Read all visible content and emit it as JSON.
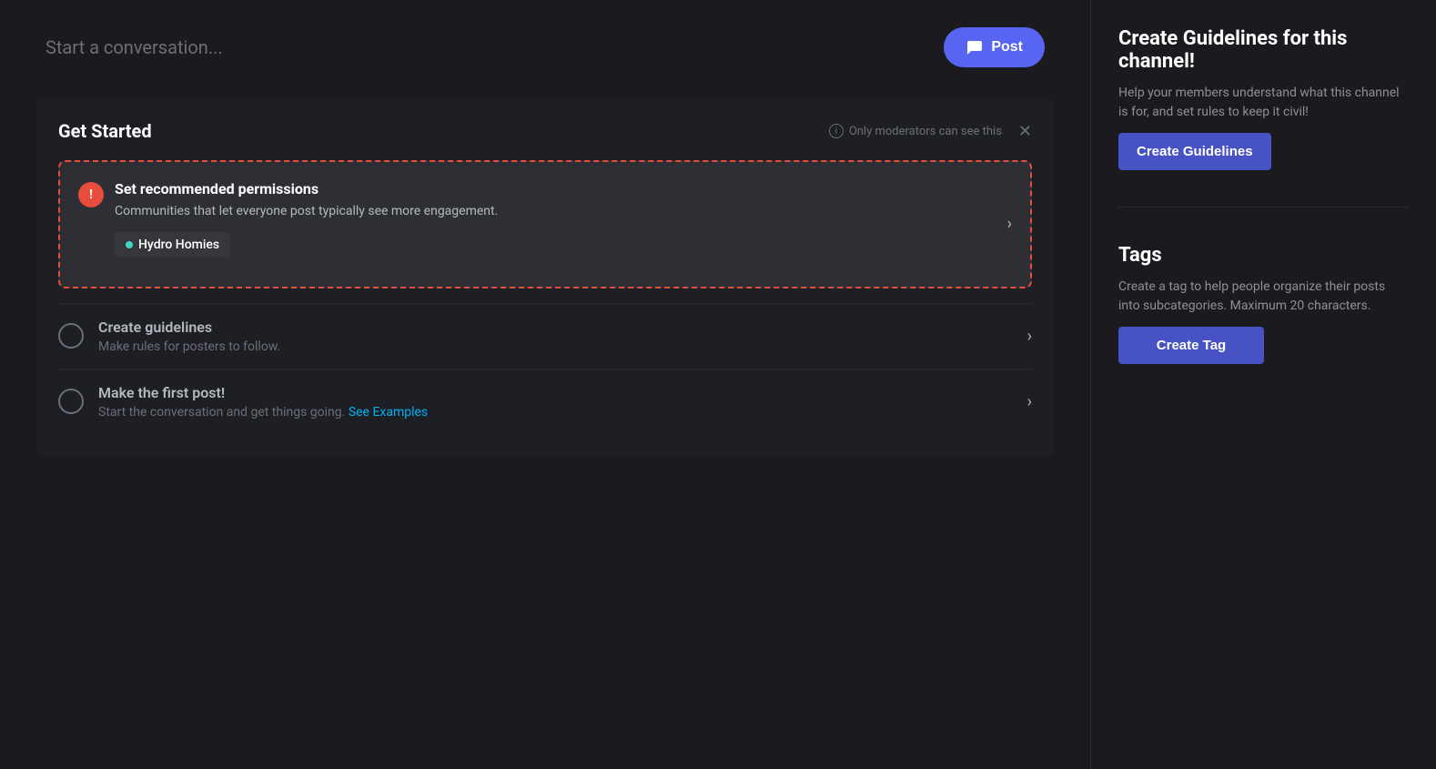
{
  "conversation_bar": {
    "placeholder": "Start a conversation...",
    "post_button_label": "Post"
  },
  "get_started": {
    "title": "Get Started",
    "moderator_notice": "Only moderators can see this",
    "highlighted_card": {
      "title": "Set recommended permissions",
      "description": "Communities that let everyone post typically see more engagement.",
      "tag_label": "Hydro Homies"
    },
    "items": [
      {
        "title": "Create guidelines",
        "description": "Make rules for posters to follow."
      },
      {
        "title": "Make the first post!",
        "description": "Start the conversation and get things going.",
        "link_text": "See Examples"
      }
    ]
  },
  "sidebar": {
    "guidelines_section": {
      "title": "Create Guidelines for this channel!",
      "description": "Help your members understand what this channel is for, and set rules to keep it civil!",
      "button_label": "Create Guidelines"
    },
    "tags_section": {
      "title": "Tags",
      "description": "Create a tag to help people organize their posts into subcategories. Maximum 20 characters.",
      "button_label": "Create Tag"
    }
  }
}
